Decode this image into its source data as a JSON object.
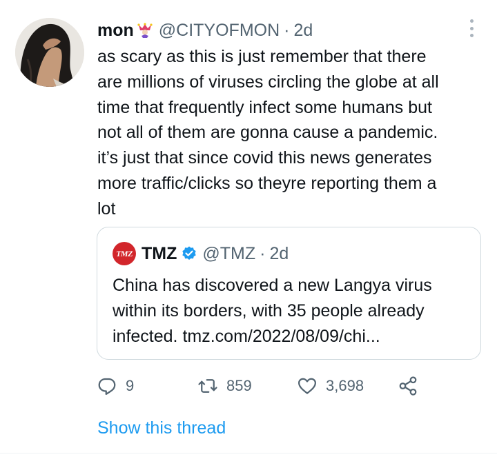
{
  "tweet": {
    "author_name": "mon",
    "author_emoji": "jester-emoji",
    "author_handle": "@CITYOFMON",
    "separator": "·",
    "time_ago": "2d",
    "text": "as scary as this is just remember that there\nare millions of viruses circling the globe at all\ntime that frequently infect some humans but\nnot all of them are gonna cause a pandemic.\nit’s just that since covid this news generates\nmore traffic/clicks so theyre reporting them a\nlot"
  },
  "quoted_tweet": {
    "logo_text": "TMZ",
    "author_name": "TMZ",
    "verified": true,
    "author_handle": "@TMZ",
    "separator": "·",
    "time_ago": "2d",
    "text": "China has discovered a new Langya virus\nwithin its borders, with 35 people already\ninfected. tmz.com/2022/08/09/chi..."
  },
  "actions": {
    "replies": "9",
    "retweets": "859",
    "likes": "3,698"
  },
  "show_thread_label": "Show this thread",
  "colors": {
    "text": "#0f1419",
    "secondary": "#536471",
    "link": "#1d9bf0",
    "verified": "#1d9bf0",
    "tmz_red": "#d2262b",
    "border": "#cfd9de"
  },
  "icons": [
    "more-options-icon",
    "reply-icon",
    "retweet-icon",
    "like-icon",
    "share-icon",
    "verified-badge-icon"
  ]
}
